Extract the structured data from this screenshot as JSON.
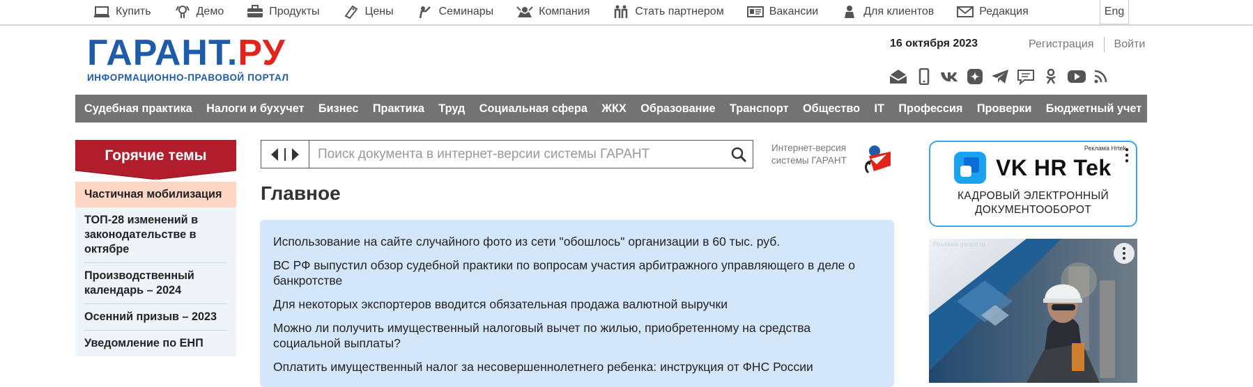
{
  "topbar": {
    "items": [
      {
        "label": "Купить",
        "icon": "laptop-icon"
      },
      {
        "label": "Демо",
        "icon": "demo-icon"
      },
      {
        "label": "Продукты",
        "icon": "briefcase-icon"
      },
      {
        "label": "Цены",
        "icon": "tag-icon"
      },
      {
        "label": "Семинары",
        "icon": "seminar-icon"
      },
      {
        "label": "Компания",
        "icon": "company-icon"
      },
      {
        "label": "Стать партнером",
        "icon": "partners-icon"
      },
      {
        "label": "Вакансии",
        "icon": "id-card-icon"
      },
      {
        "label": "Для клиентов",
        "icon": "client-icon"
      },
      {
        "label": "Редакция",
        "icon": "envelope-icon"
      }
    ],
    "lang": "Eng"
  },
  "header": {
    "logo_main": "ГАРАНТ",
    "logo_dot": ".",
    "logo_ru": "РУ",
    "logo_sub": "ИНФОРМАЦИОННО-ПРАВОВОЙ ПОРТАЛ",
    "date": "16 октября 2023",
    "register": "Регистрация",
    "login": "Войти",
    "social": [
      "mail-icon",
      "mobile-icon",
      "vk-icon",
      "dzen-icon",
      "telegram-icon",
      "chat-icon",
      "ok-icon",
      "youtube-icon",
      "rss-icon"
    ]
  },
  "nav": {
    "items": [
      "Судебная практика",
      "Налоги и бухучет",
      "Бизнес",
      "Практика",
      "Труд",
      "Социальная сфера",
      "ЖКХ",
      "Образование",
      "Транспорт",
      "Общество",
      "IT",
      "Профессия",
      "Проверки",
      "Бюджетный учет"
    ]
  },
  "hot": {
    "title": "Горячие темы",
    "items": [
      "Частичная мобилизация",
      "ТОП-28 изменений в законодательстве в октябре",
      "Производственный календарь – 2024",
      "Осенний призыв – 2023",
      "Уведомление по ЕНП"
    ]
  },
  "search": {
    "placeholder": "Поиск документа в интернет-версии системы ГАРАНТ"
  },
  "inet": {
    "line1": "Интернет-версия",
    "line2": "системы ГАРАНТ"
  },
  "main": {
    "title": "Главное",
    "news": [
      "Использование на сайте случайного фото из сети \"обошлось\" организации в 60 тыс. руб.",
      "ВС РФ выпустил обзор судебной практики по вопросам участия арбитражного управляющего в деле о банкротстве",
      "Для некоторых экспортеров вводится обязательная продажа валютной выручки",
      "Можно ли получить имущественный налоговый вычет по жилью, приобретенному на средства социальной выплаты?",
      "Оплатить имущественный налог за несовершеннолетнего ребенка: инструкция от ФНС России"
    ]
  },
  "ads": {
    "ad1_label": "Реклама Hrtek",
    "ad1_brand": "VK HR Tek",
    "ad1_sub1": "КАДРОВЫЙ ЭЛЕКТРОННЫЙ",
    "ad1_sub2": "ДОКУМЕНТООБОРОТ",
    "ad2_label": "Реклама garant.ru"
  },
  "colors": {
    "brand_blue": "#1e5ba8",
    "brand_red": "#e2231a",
    "nav_bg": "#737373",
    "hot_red": "#b11e2b",
    "news_bg": "#d4e6fa"
  }
}
